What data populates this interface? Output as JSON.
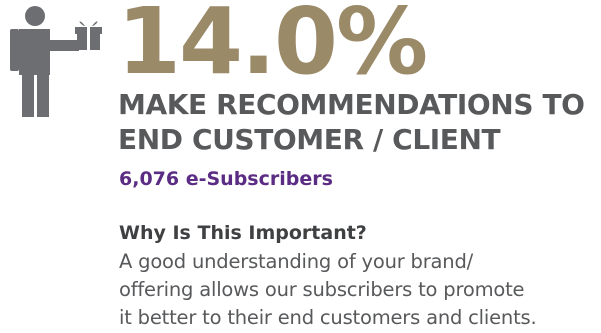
{
  "colors": {
    "percent": "#9a8a68",
    "headline": "#58595b",
    "subscribers": "#5b2c83",
    "heading": "#3f4042",
    "body": "#58595b",
    "icon": "#6d6e71"
  },
  "icon": {
    "name": "person-holding-gift-icon"
  },
  "stat": {
    "percent": "14.0%",
    "headline_line1": "MAKE RECOMMENDATIONS TO",
    "headline_line2": "END CUSTOMER / CLIENT",
    "subscribers": "6,076 e-Subscribers"
  },
  "why": {
    "heading": "Why Is This Important?",
    "lines": [
      "A good understanding of your brand/",
      "offering allows our subscribers to promote",
      "it better to their end customers and clients."
    ]
  }
}
